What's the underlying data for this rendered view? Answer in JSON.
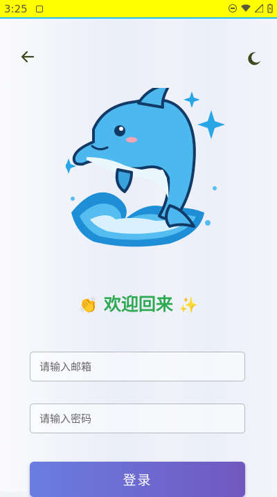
{
  "status_bar": {
    "time": "3:25"
  },
  "colors": {
    "status_bar_bg": "#ffff00",
    "accent_green": "#2ea952",
    "button_gradient_start": "#6a7de0",
    "button_gradient_end": "#7058c0",
    "icon_dark": "#3b4a1e"
  },
  "header": {
    "back_icon": "arrow-left-icon",
    "theme_icon": "moon-icon"
  },
  "hero": {
    "illustration": "dolphin-icon"
  },
  "welcome": {
    "emoji_left": "👏",
    "text": "欢迎回来",
    "emoji_right": "✨"
  },
  "form": {
    "email_placeholder": "请输入邮箱",
    "password_placeholder": "请输入密码",
    "login_label": "登录"
  }
}
